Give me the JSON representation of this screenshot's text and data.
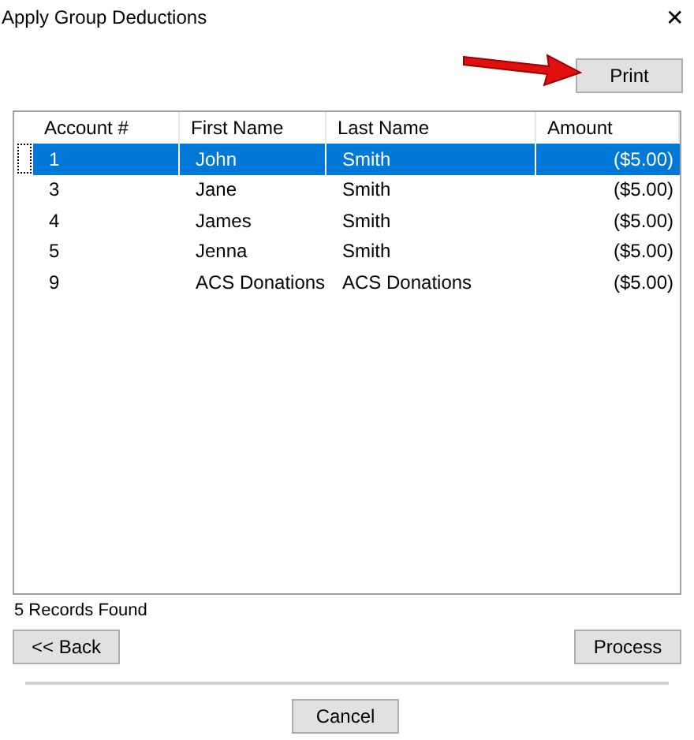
{
  "window": {
    "title": "Apply Group Deductions",
    "close": "✕"
  },
  "print_button": "Print",
  "table": {
    "columns": [
      "Account #",
      "First Name",
      "Last Name",
      "Amount"
    ],
    "rows": [
      {
        "cells": [
          "1",
          "John",
          "Smith",
          "($5.00)"
        ],
        "selected": true
      },
      {
        "cells": [
          "3",
          "Jane",
          "Smith",
          "($5.00)"
        ],
        "selected": false
      },
      {
        "cells": [
          "4",
          "James",
          "Smith",
          "($5.00)"
        ],
        "selected": false
      },
      {
        "cells": [
          "5",
          "Jenna",
          "Smith",
          "($5.00)"
        ],
        "selected": false
      },
      {
        "cells": [
          "9",
          "ACS Donations",
          "ACS Donations",
          "($5.00)"
        ],
        "selected": false
      }
    ]
  },
  "status": "5 Records Found",
  "back_button": "<< Back",
  "process_button": "Process",
  "cancel_button": "Cancel"
}
